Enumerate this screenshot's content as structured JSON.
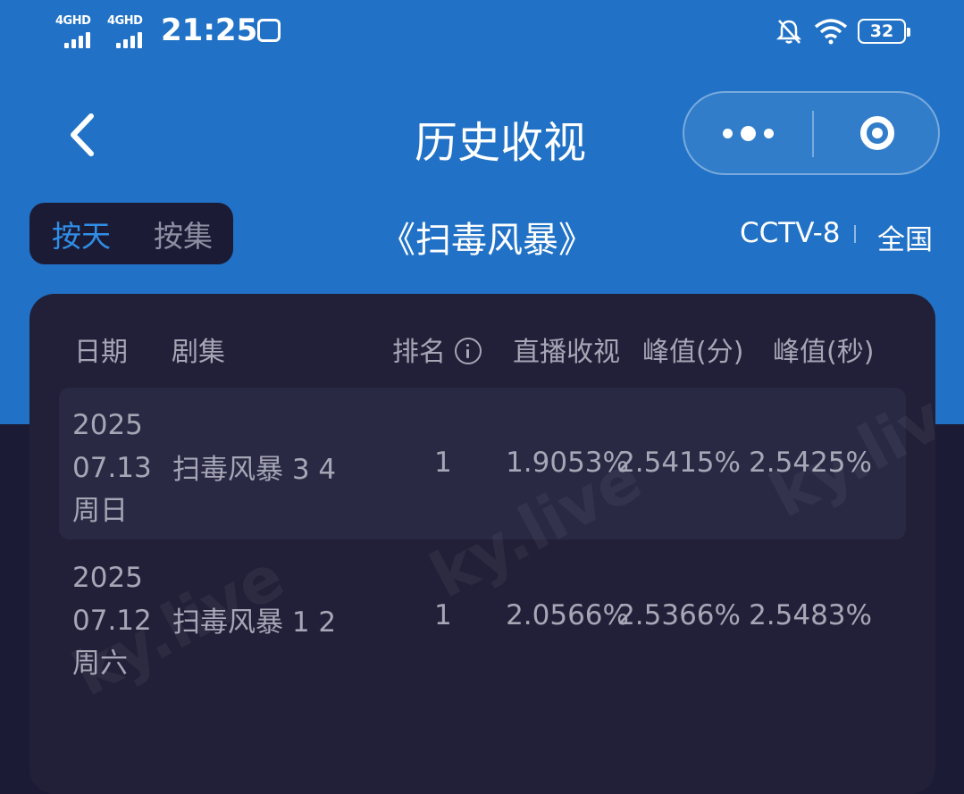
{
  "statusbar": {
    "network1": "4GHD",
    "network2": "4GHD",
    "time": "21:25",
    "battery": "32"
  },
  "nav": {
    "title": "历史收视"
  },
  "filter": {
    "by_day": "按天",
    "by_episode": "按集",
    "show_title": "《扫毒风暴》",
    "channel": "CCTV-8",
    "region": "全国"
  },
  "table": {
    "headers": {
      "date": "日期",
      "episode": "剧集",
      "rank": "排名",
      "live_rating": "直播收视",
      "peak_min": "峰值(分)",
      "peak_sec": "峰值(秒)"
    },
    "rows": [
      {
        "year": "2025",
        "date": "07.13",
        "weekday": "周日",
        "episode": "扫毒风暴 3 4",
        "rank": "1",
        "live_rating": "1.9053%",
        "peak_min": "2.5415%",
        "peak_sec": "2.5425%"
      },
      {
        "year": "2025",
        "date": "07.12",
        "weekday": "周六",
        "episode": "扫毒风暴 1 2",
        "rank": "1",
        "live_rating": "2.0566%",
        "peak_min": "2.5366%",
        "peak_sec": "2.5483%"
      }
    ]
  },
  "watermark": "ky.live",
  "colors": {
    "header_blue": "#2172c6",
    "card_bg": "#212038",
    "active_toggle": "#2f8ee6"
  }
}
